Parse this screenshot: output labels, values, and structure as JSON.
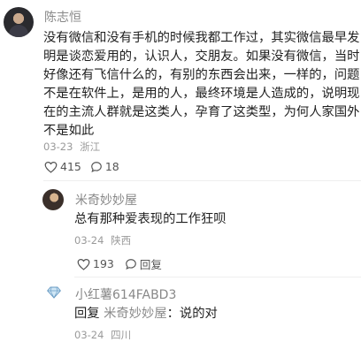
{
  "main_comment": {
    "username": "陈志恒",
    "content_lines": [
      "没有微信和没有手机的时候我都工作过，其实微信最早发",
      "明是谈恋爱用的，认识人，交朋友。如果没有微信，当时",
      "好像还有飞信什么的，有别的东西会出来，一样的，问题",
      "不是在软件上，是用的人，最终环境是人造成的，说明现",
      "在的主流人群就是这类人，孕育了这类型，为何人家国外",
      "不是如此"
    ],
    "date": "03-23",
    "location": "浙江",
    "likes": "415",
    "replies": "18"
  },
  "replies": [
    {
      "username": "米奇妙妙屋",
      "content": "总有那种爱表现的工作狂呗",
      "date": "03-24",
      "location": "陕西",
      "likes": "193",
      "reply_label": "回复"
    },
    {
      "username": "小红薯614FABD3",
      "reply_prefix": "回复",
      "mention": "米奇妙妙屋",
      "content": "：说的对",
      "date": "03-24",
      "location": "四川"
    }
  ],
  "colors": {
    "text": "#1f1f1f",
    "muted": "#888888",
    "meta": "#9a9a9a",
    "divider": "#eeeeee"
  },
  "icons": [
    "like-heart-icon",
    "comment-bubble-icon",
    "diamond-badge-icon"
  ]
}
